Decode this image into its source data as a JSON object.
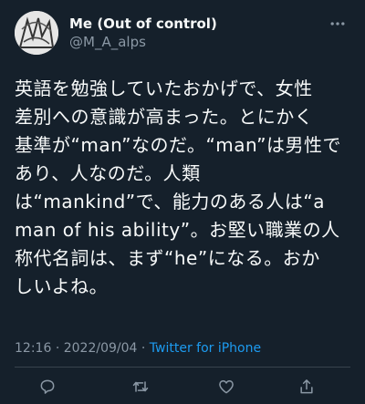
{
  "tweet": {
    "display_name": "Me (Out of control)",
    "handle": "@M_A_alps",
    "text_lines": [
      "英語を勉強していたおかげで、女性",
      "差別への意識が高まった。とにかく",
      "基準が“man”なのだ。“man”は男性で",
      "あり、人なのだ。人類",
      "は“mankind”で、能力のある人は“a",
      "man of his ability”。お堅い職業の人",
      "称代名詞は、まず“he”になる。おか",
      "しいよね。"
    ],
    "time": "12:16",
    "separator": "·",
    "date": "2022/09/04",
    "source": "Twitter for iPhone"
  },
  "icons": {
    "more": "more-dots-icon",
    "reply": "reply-icon",
    "retweet": "retweet-icon",
    "like": "heart-icon",
    "share": "share-icon"
  },
  "colors": {
    "background": "#15202b",
    "text": "#f7f9f9",
    "secondary": "#8b98a5",
    "link": "#1d9bf0",
    "divider": "#38444d"
  }
}
